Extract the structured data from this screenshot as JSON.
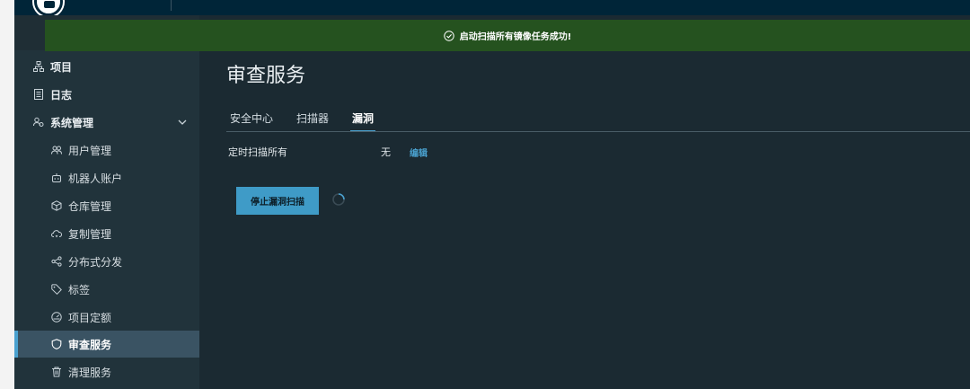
{
  "banner": {
    "message": "启动扫描所有镜像任务成功!"
  },
  "nav": {
    "projects": "项目",
    "logs": "日志",
    "admin": "系统管理",
    "items": [
      {
        "label": "用户管理",
        "icon": "users-icon"
      },
      {
        "label": "机器人账户",
        "icon": "robot-icon"
      },
      {
        "label": "仓库管理",
        "icon": "cube-icon"
      },
      {
        "label": "复制管理",
        "icon": "cloud-sync-icon"
      },
      {
        "label": "分布式分发",
        "icon": "share-icon"
      },
      {
        "label": "标签",
        "icon": "tag-icon"
      },
      {
        "label": "项目定额",
        "icon": "dashboard-icon"
      },
      {
        "label": "审查服务",
        "icon": "shield-icon",
        "active": true
      },
      {
        "label": "清理服务",
        "icon": "trash-icon"
      }
    ]
  },
  "page": {
    "title": "审查服务"
  },
  "tabs": [
    {
      "label": "安全中心"
    },
    {
      "label": "扫描器"
    },
    {
      "label": "漏洞",
      "active": true
    }
  ],
  "schedule": {
    "label": "定时扫描所有",
    "value": "无",
    "edit": "编辑"
  },
  "actions": {
    "stop_scan": "停止漏洞扫描"
  },
  "colors": {
    "accent": "#4aa1cf",
    "success_banner": "#25521f",
    "topbar": "#002538"
  }
}
